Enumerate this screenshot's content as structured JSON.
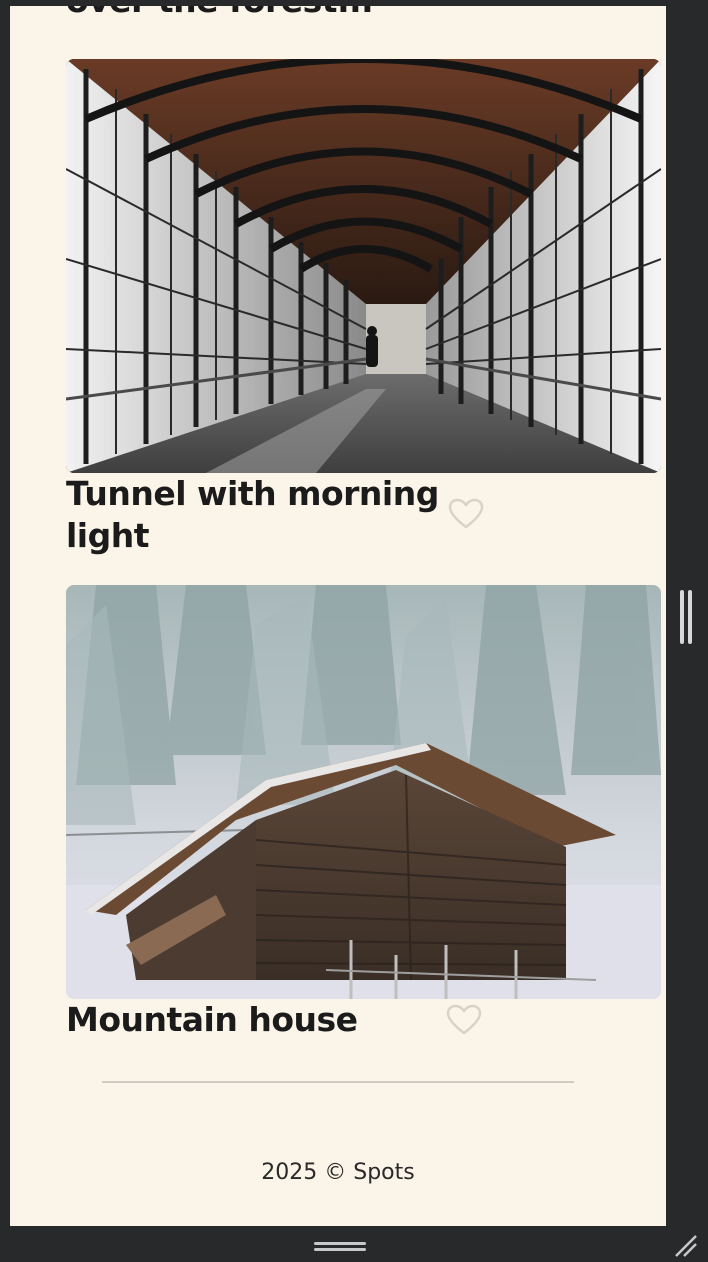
{
  "cards": {
    "previous": {
      "title": "over the forest..."
    },
    "tunnel": {
      "title": "Tunnel with morning light"
    },
    "house": {
      "title": "Mountain house"
    }
  },
  "icons": {
    "like": "heart-outline-icon",
    "scrollbar": "scrollbar-handle",
    "resize": "resize-grip-icon"
  },
  "footer": {
    "text": "2025 © Spots"
  },
  "colors": {
    "page_background": "#fbf4e8",
    "chrome_background": "#28292b",
    "title_text": "#1b1b1b",
    "heart_outline": "#d8d2c8",
    "divider": "#cfcac2"
  }
}
